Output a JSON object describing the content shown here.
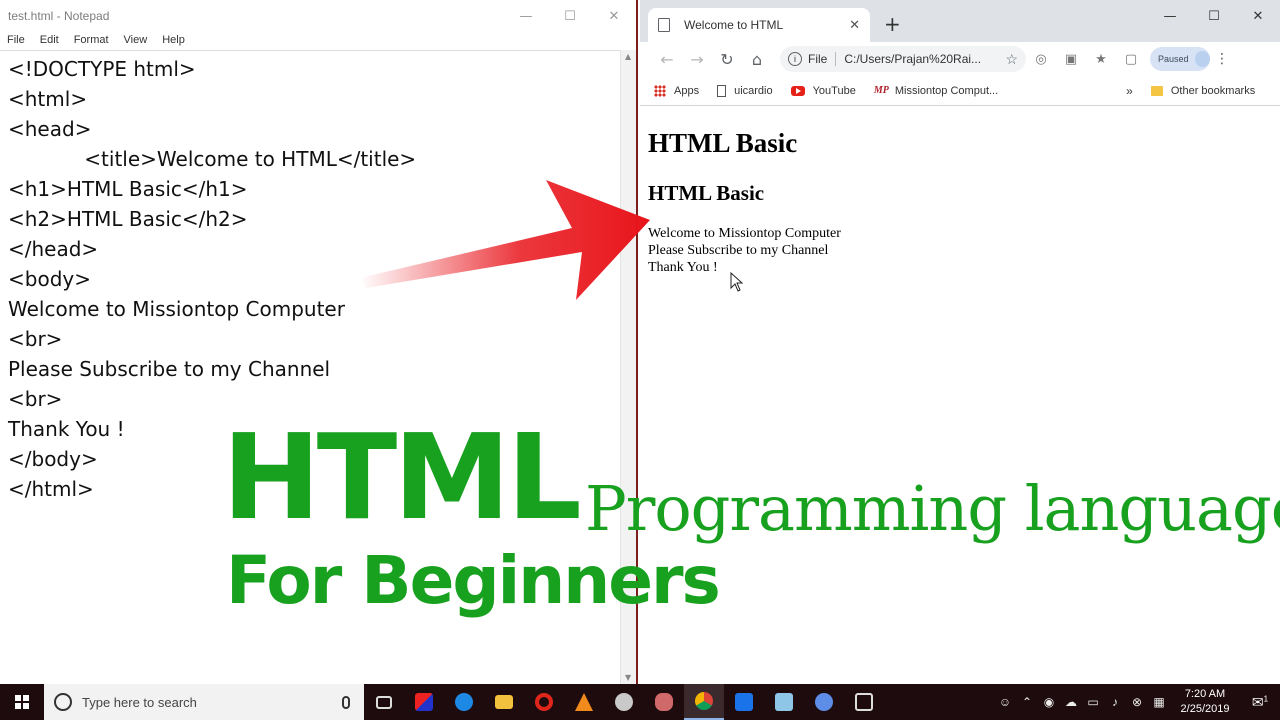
{
  "notepad": {
    "title": "test.html - Notepad",
    "menu": [
      "File",
      "Edit",
      "Format",
      "View",
      "Help"
    ],
    "lines": [
      "<!DOCTYPE html>",
      "<html>",
      "<head>",
      "            <title>Welcome to HTML</title>",
      "<h1>HTML Basic</h1>",
      "<h2>HTML Basic</h2>",
      "</head>",
      "<body>",
      "Welcome to Missiontop Computer",
      "<br>",
      "Please Subscribe to my Channel",
      "<br>",
      "Thank You !",
      "</body>",
      "</html>"
    ]
  },
  "browser": {
    "tab_title": "Welcome to HTML",
    "address_scheme": "File",
    "address_url": "C:/Users/Prajan%20Rai...",
    "profile_label": "Paused",
    "bookmarks": [
      "Apps",
      "uicardio",
      "YouTube",
      "Missiontop Comput..."
    ],
    "other_bookmarks": "Other bookmarks",
    "more_bookmarks": "»",
    "page": {
      "h1": "HTML Basic",
      "h2": "HTML Basic",
      "lines": [
        "Welcome to Missiontop Computer",
        "Please Subscribe to my Channel",
        "Thank You !"
      ]
    }
  },
  "overlay": {
    "big_word": "HTML",
    "subtitle": "Programming language",
    "tagline": "For Beginners",
    "text_color": "#18a01f",
    "arrow_color": "#e8151b"
  },
  "taskbar": {
    "search_placeholder": "Type here to search",
    "time": "7:20 AM",
    "date": "2/25/2019",
    "notification_count": "1"
  },
  "colors": {
    "taskbar_bg": "#1d0b0e",
    "tabstrip_bg": "#dee1e6",
    "divider": "#7a1e1e"
  }
}
